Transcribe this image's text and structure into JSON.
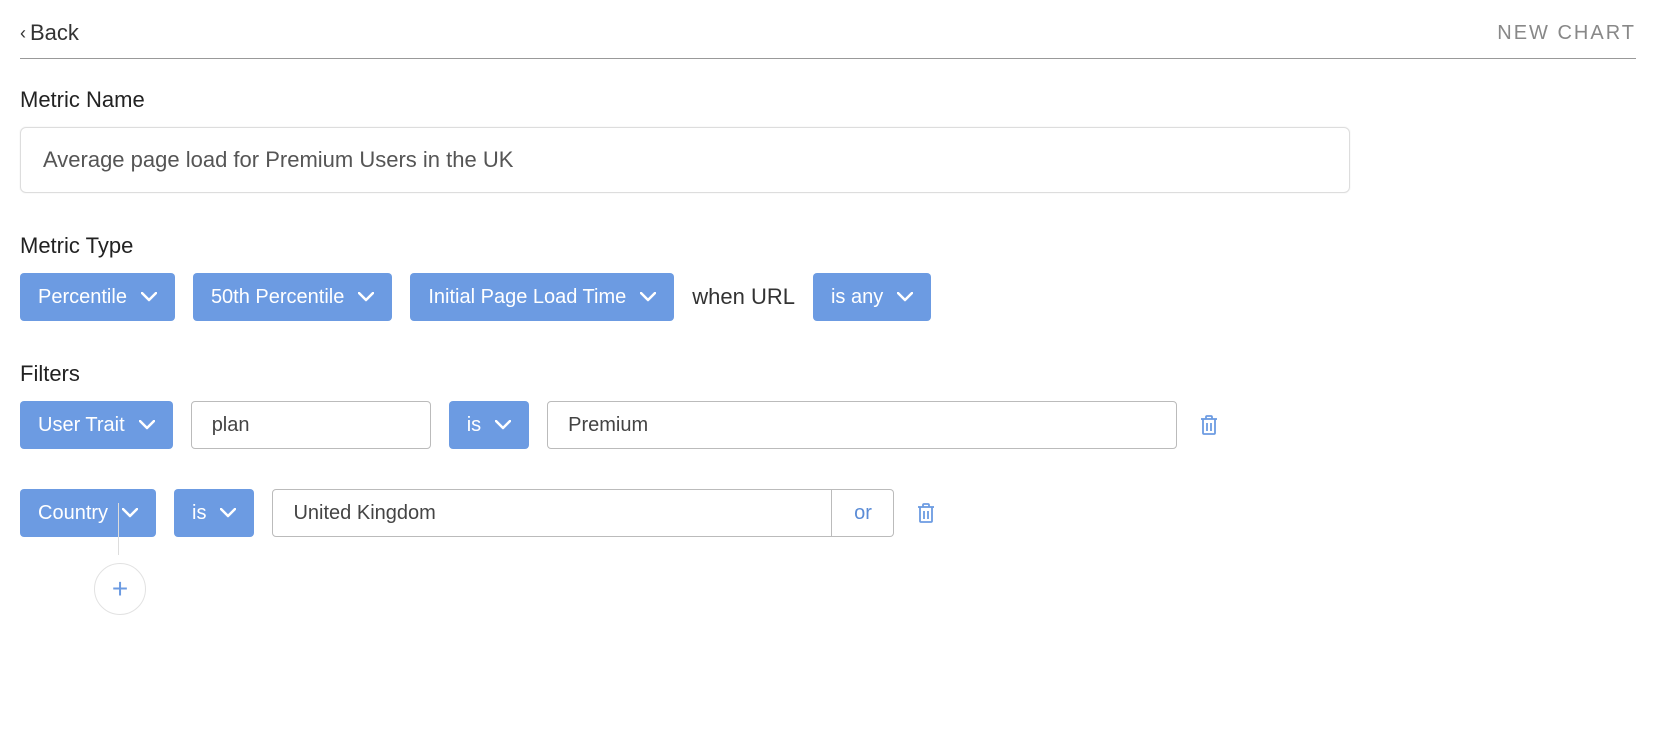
{
  "header": {
    "back_label": "Back",
    "page_title": "NEW CHART"
  },
  "metric_name": {
    "label": "Metric Name",
    "value": "Average page load for Premium Users in the UK"
  },
  "metric_type": {
    "label": "Metric Type",
    "aggregation": "Percentile",
    "percentile": "50th Percentile",
    "measure": "Initial Page Load Time",
    "url_prefix": "when URL",
    "url_condition": "is any"
  },
  "filters": {
    "label": "Filters",
    "rows": [
      {
        "type": "User Trait",
        "field": "plan",
        "operator": "is",
        "value": "Premium"
      },
      {
        "type": "Country",
        "operator": "is",
        "value": "United Kingdom",
        "or_label": "or"
      }
    ]
  },
  "icons": {
    "add": "+"
  }
}
